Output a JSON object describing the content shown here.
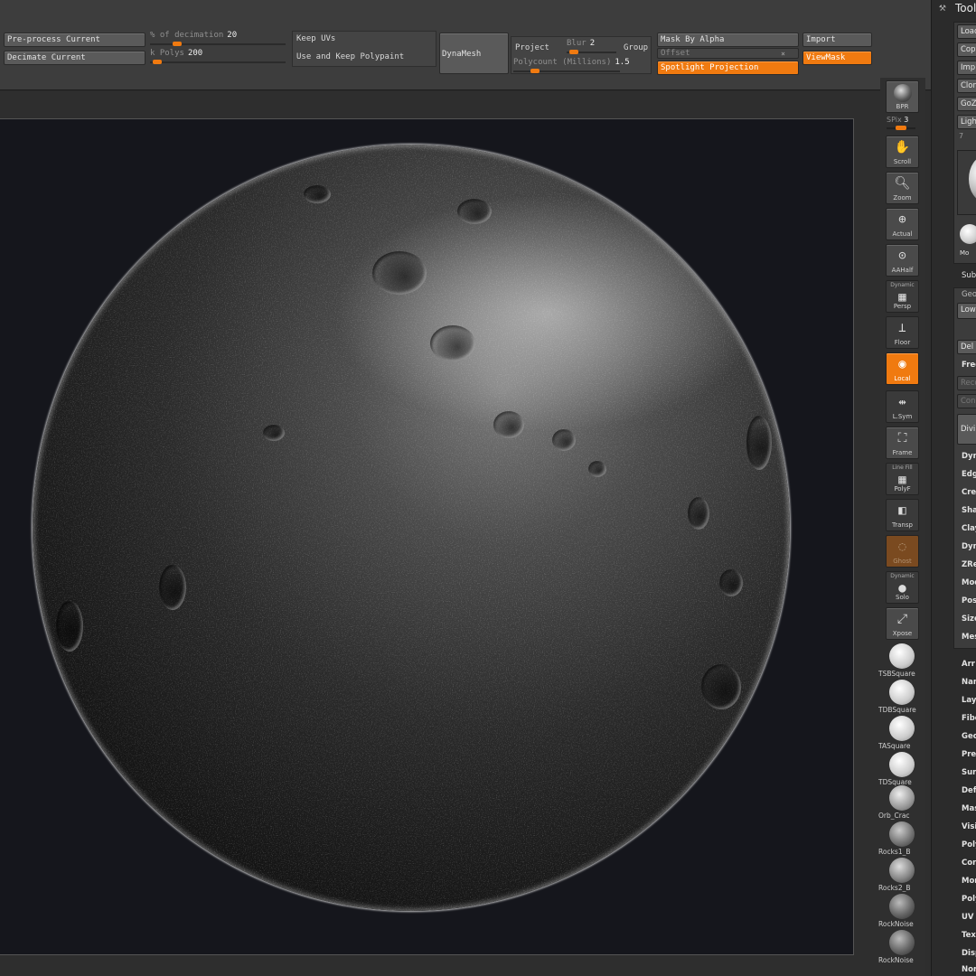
{
  "top_shelf": {
    "preprocess_label": "Pre-process Current",
    "decimate_label": "Decimate Current",
    "pct_decimation_label": "% of decimation",
    "pct_decimation_value": "20",
    "pct_decimation_fraction": 0.2,
    "k_polys_label": "k Polys",
    "k_polys_value": "200",
    "k_polys_fraction": 0.05,
    "keep_uvs_label": "Keep UVs",
    "keep_polypaint_label": "Use and Keep Polypaint",
    "dynamesh_label": "DynaMesh",
    "project_label": "Project",
    "blur_label": "Blur",
    "blur_value": "2",
    "blur_fraction": 0.15,
    "group_label": "Group",
    "polycount_label": "Polycount (Millions)",
    "polycount_value": "1.5",
    "polycount_fraction": 0.2,
    "mask_by_alpha_label": "Mask By Alpha",
    "offset_label": "Offset",
    "spotlight_label": "Spotlight Projection",
    "import_label": "Import",
    "viewmask_label": "ViewMask"
  },
  "right_strip": {
    "bpr_label": "BPR",
    "spix_label": "SPix",
    "spix_value": "3",
    "scroll_label": "Scroll",
    "zoom_label": "Zoom",
    "actual_label": "Actual",
    "aahalf_label": "AAHalf",
    "dynamic_label": "Dynamic",
    "persp_label": "Persp",
    "floor_label": "Floor",
    "local_label": "Local",
    "sym_label": "L.Sym",
    "frame_label": "Frame",
    "linefill_label": "Line Fill",
    "polyf_label": "PolyF",
    "transp_label": "Transp",
    "ghost_label": "Ghost",
    "dynamic2_label": "Dynamic",
    "solo_label": "Solo",
    "xpose_label": "Xpose",
    "brushes": [
      {
        "label": "TSBSquare"
      },
      {
        "label": "TDBSquare"
      },
      {
        "label": "TASquare"
      },
      {
        "label": "TDSquare"
      },
      {
        "label": "Orb_Crac"
      },
      {
        "label": "Rocks1_B"
      },
      {
        "label": "Rocks2_B"
      },
      {
        "label": "RockNoise"
      },
      {
        "label": "RockNoise"
      }
    ]
  },
  "tool_palette": {
    "title": "Tool",
    "buttons": [
      "Load",
      "Copy",
      "Imp",
      "Clon",
      "GoZ",
      "Ligh"
    ],
    "subtool_count": "7",
    "model_label": "Mo",
    "subtool_label": "Sub",
    "geometry_label": "Geo",
    "lower_label": "Low",
    "del_label": "Del",
    "freeze_label": "Free",
    "rec_label": "Reco",
    "con_label": "Conv",
    "divide_label": "Divi",
    "section_items": [
      "Dyn",
      "Edg",
      "Crea",
      "Sha",
      "Clay",
      "Dyn",
      "ZRe",
      "Mod",
      "Posi",
      "Size",
      "Mes"
    ],
    "menu_items": [
      "Arr",
      "Nan",
      "Lay",
      "Fibe",
      "Geo",
      "Pre",
      "Surf",
      "Def",
      "Mas",
      "Visi",
      "Poly",
      "Con",
      "Mor",
      "Poly",
      "UV",
      "Tex",
      "Disp",
      "Nor"
    ]
  }
}
